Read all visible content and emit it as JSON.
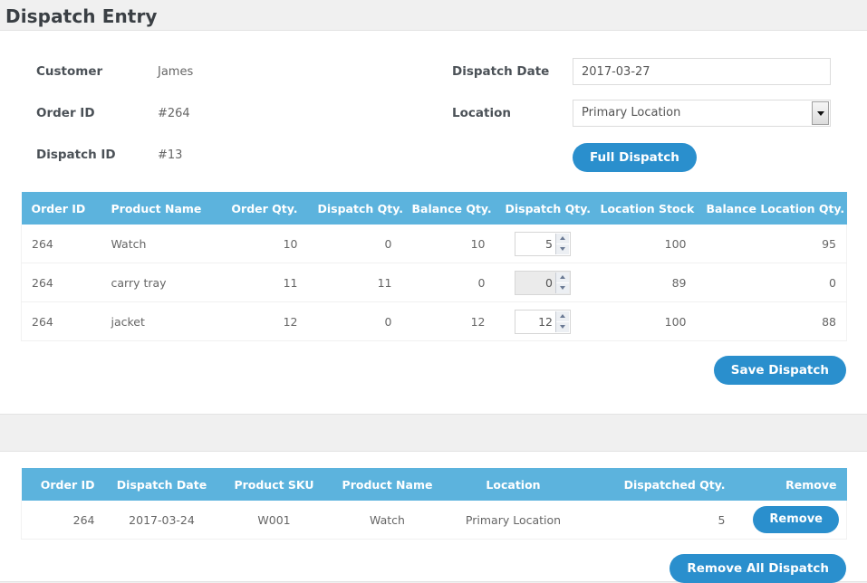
{
  "page": {
    "title": "Dispatch Entry",
    "accent_blue": "#2a8fcd",
    "header_blue": "#5cb3dd",
    "background": "#f0f0f0"
  },
  "form": {
    "customer_label": "Customer",
    "customer_value": "James",
    "order_id_label": "Order ID",
    "order_id_value": "#264",
    "dispatch_id_label": "Dispatch ID",
    "dispatch_id_value": "#13",
    "dispatch_date_label": "Dispatch Date",
    "dispatch_date_value": "2017-03-27",
    "dispatch_date_placeholder": "",
    "location_label": "Location",
    "location_value": "Primary Location",
    "location_options": [
      "Primary Location"
    ],
    "full_dispatch_button": "Full Dispatch"
  },
  "items_table": {
    "columns": [
      "Order ID",
      "Product Name",
      "Order Qty.",
      "Dispatch Qty.",
      "Balance Qty.",
      "Dispatch Qty.",
      "Location Stock",
      "Balance Location Qty."
    ],
    "rows": [
      {
        "order_id": "264",
        "product_name": "Watch",
        "order_qty": "10",
        "dispatch_qty": "0",
        "balance_qty": "10",
        "dispatch_qty_input": "5",
        "dispatch_qty_disabled": false,
        "location_stock": "100",
        "balance_location_qty": "95"
      },
      {
        "order_id": "264",
        "product_name": "carry tray",
        "order_qty": "11",
        "dispatch_qty": "11",
        "balance_qty": "0",
        "dispatch_qty_input": "0",
        "dispatch_qty_disabled": true,
        "location_stock": "89",
        "balance_location_qty": "0"
      },
      {
        "order_id": "264",
        "product_name": "jacket",
        "order_qty": "12",
        "dispatch_qty": "0",
        "balance_qty": "12",
        "dispatch_qty_input": "12",
        "dispatch_qty_disabled": false,
        "location_stock": "100",
        "balance_location_qty": "88"
      }
    ],
    "save_button": "Save Dispatch"
  },
  "dispatched_table": {
    "columns": [
      "Order ID",
      "Dispatch Date",
      "Product SKU",
      "Product Name",
      "Location",
      "Dispatched Qty.",
      "Remove"
    ],
    "rows": [
      {
        "order_id": "264",
        "dispatch_date": "2017-03-24",
        "product_sku": "W001",
        "product_name": "Watch",
        "location": "Primary Location",
        "dispatched_qty": "5",
        "remove_label": "Remove"
      }
    ],
    "remove_all_button": "Remove All Dispatch"
  }
}
